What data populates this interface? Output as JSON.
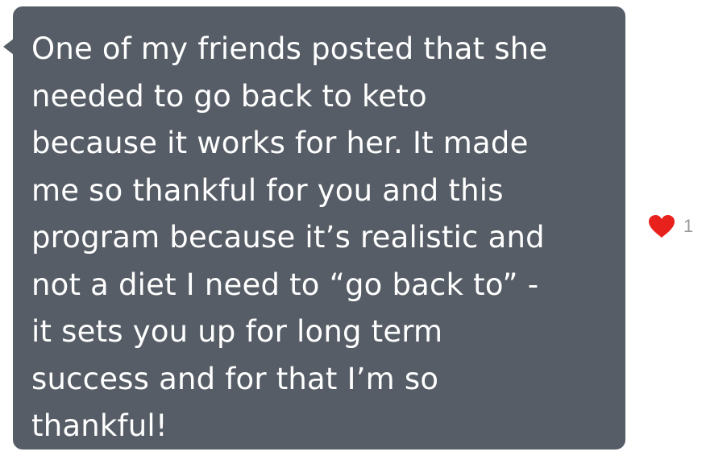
{
  "message": {
    "text": "One of my friends posted that she\nneeded to go back to keto\nbecause it works for her. It made\nme so thankful for you and this\nprogram because it’s realistic and\nnot a diet I need to “go back to” -\nit sets you up for long term\nsuccess and for that I’m so\nthankful!",
    "bubble_color": "#565d66",
    "text_color": "#ffffff"
  },
  "reaction": {
    "icon": "heart-icon",
    "color": "#e8211c",
    "count": "1"
  }
}
